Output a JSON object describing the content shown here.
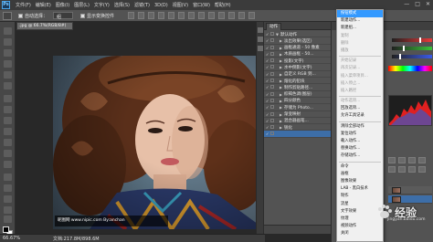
{
  "app": {
    "logo": "Ps",
    "menus": [
      "文件(F)",
      "编辑(E)",
      "图像(I)",
      "图层(L)",
      "文字(Y)",
      "选择(S)",
      "滤镜(T)",
      "3D(D)",
      "视图(V)",
      "窗口(W)",
      "帮助(H)"
    ],
    "window_controls": [
      "—",
      "□",
      "✕"
    ]
  },
  "options": {
    "auto_select_label": "自动选择：",
    "auto_select_value": "组",
    "transform_label": "显示变换控件"
  },
  "document": {
    "tab_label": ".jpg @ 66.7%(RGB/8#)",
    "watermark_text": "昵图网 www.nipic.com   By:anchan"
  },
  "statusbar": {
    "zoom": "66.67%",
    "doc_info": "文档:217.8M/898.6M"
  },
  "actions_panel": {
    "tab_label": "动作",
    "rows": [
      {
        "check": "✓",
        "twisty": "▼",
        "label": "默认动作",
        "selected": false
      },
      {
        "check": "✓",
        "twisty": "▶",
        "label": "淡出效果(选区)",
        "selected": false
      },
      {
        "check": "✓",
        "twisty": "▶",
        "label": "画框通道 - 50 像素",
        "selected": false
      },
      {
        "check": "✓",
        "twisty": "▶",
        "label": "木质画框 - 50...",
        "selected": false
      },
      {
        "check": "✓",
        "twisty": "▶",
        "label": "投影(文字)",
        "selected": false
      },
      {
        "check": "✓",
        "twisty": "▶",
        "label": "水中倒影(文字)",
        "selected": false
      },
      {
        "check": "✓",
        "twisty": "▶",
        "label": "自定义 RGB 到...",
        "selected": false
      },
      {
        "check": "✓",
        "twisty": "▶",
        "label": "熔化的铅块",
        "selected": false
      },
      {
        "check": "✓",
        "twisty": "▶",
        "label": "制作剪贴路径...",
        "selected": false
      },
      {
        "check": "✓",
        "twisty": "▶",
        "label": "棕褐色调(图层)",
        "selected": false
      },
      {
        "check": "✓",
        "twisty": "▶",
        "label": "四分颜色",
        "selected": false
      },
      {
        "check": "✓",
        "twisty": "▶",
        "label": "存储为 Photo...",
        "selected": false
      },
      {
        "check": "✓",
        "twisty": "▶",
        "label": "渐变映射",
        "selected": false
      },
      {
        "check": "✓",
        "twisty": "▶",
        "label": "混合器画笔...",
        "selected": false
      },
      {
        "check": "✓",
        "twisty": "▶",
        "label": "锐化",
        "selected": false
      },
      {
        "check": "✓",
        "twisty": "",
        "label": "",
        "selected": true
      }
    ]
  },
  "flyout_menu": {
    "items": [
      {
        "label": "按钮模式",
        "state": "highlight"
      },
      {
        "label": "新建动作...",
        "state": "normal"
      },
      {
        "label": "新建组...",
        "state": "normal"
      },
      {
        "label": "复制",
        "state": "disabled"
      },
      {
        "label": "删除",
        "state": "disabled"
      },
      {
        "label": "播放",
        "state": "disabled"
      },
      {
        "sep": true
      },
      {
        "label": "开始记录",
        "state": "disabled"
      },
      {
        "label": "再次记录...",
        "state": "disabled"
      },
      {
        "label": "插入菜单项目...",
        "state": "disabled"
      },
      {
        "label": "插入停止...",
        "state": "disabled"
      },
      {
        "label": "插入路径",
        "state": "disabled"
      },
      {
        "sep": true
      },
      {
        "label": "动作选项...",
        "state": "disabled"
      },
      {
        "label": "回放选项...",
        "state": "normal"
      },
      {
        "label": "允许工具记录",
        "state": "normal"
      },
      {
        "sep": true
      },
      {
        "label": "清除全部动作",
        "state": "normal"
      },
      {
        "label": "复位动作",
        "state": "normal"
      },
      {
        "label": "载入动作...",
        "state": "normal"
      },
      {
        "label": "替换动作...",
        "state": "normal"
      },
      {
        "label": "存储动作...",
        "state": "normal"
      },
      {
        "sep": true
      },
      {
        "label": "命令",
        "state": "normal"
      },
      {
        "label": "画框",
        "state": "normal"
      },
      {
        "label": "图像效果",
        "state": "normal"
      },
      {
        "label": "LAB - 黑白技术",
        "state": "normal"
      },
      {
        "label": "制作",
        "state": "normal"
      },
      {
        "label": "流星",
        "state": "normal"
      },
      {
        "label": "文字效果",
        "state": "normal"
      },
      {
        "label": "纹理",
        "state": "normal"
      },
      {
        "label": "视频动作",
        "state": "normal"
      },
      {
        "label": "关闭",
        "state": "normal"
      }
    ]
  },
  "right_panel": {
    "colors": {
      "r": "#e83a3a",
      "g": "#3ac43a",
      "b": "#3a5ae8"
    }
  },
  "site_watermark": {
    "cn": "经验",
    "url": "jingyan.baidu.com"
  }
}
